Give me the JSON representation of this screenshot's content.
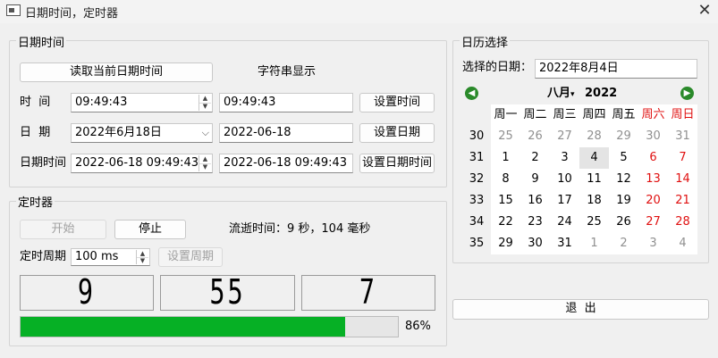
{
  "window": {
    "title": "日期时间，定时器",
    "close_glyph": "✕"
  },
  "datetime_group": {
    "title": "日期时间",
    "read_button": "读取当前日期时间",
    "string_display_label": "字符串显示",
    "time_label": "时  间",
    "time_value": "09:49:43",
    "time_string": "09:49:43",
    "set_time_button": "设置时间",
    "date_label": "日  期",
    "date_value": "2022年6月18日",
    "date_string": "2022-06-18",
    "set_date_button": "设置日期",
    "datetime_label": "日期时间",
    "datetime_value": "2022-06-18 09:49:43",
    "datetime_string": "2022-06-18 09:49:43",
    "set_datetime_button": "设置日期时间"
  },
  "timer_group": {
    "title": "定时器",
    "start_button": "开始",
    "stop_button": "停止",
    "elapsed_text": "流逝时间：9 秒，104 毫秒",
    "period_label": "定时周期",
    "period_value": "100 ms",
    "set_period_button": "设置周期",
    "lcd_hours": "9",
    "lcd_minutes": "55",
    "lcd_seconds": "7",
    "progress_percent": 86,
    "progress_text": "86%"
  },
  "calendar_group": {
    "title": "日历选择",
    "selected_label": "选择的日期：",
    "selected_value": "2022年8月4日",
    "month_label": "八月",
    "year_label": "2022",
    "weekdays": [
      "周一",
      "周二",
      "周三",
      "周四",
      "周五",
      "周六",
      "周日"
    ],
    "week_numbers": [
      "30",
      "31",
      "32",
      "33",
      "34",
      "35"
    ],
    "weeks": [
      [
        "25",
        "26",
        "27",
        "28",
        "29",
        "30",
        "31"
      ],
      [
        "1",
        "2",
        "3",
        "4",
        "5",
        "6",
        "7"
      ],
      [
        "8",
        "9",
        "10",
        "11",
        "12",
        "13",
        "14"
      ],
      [
        "15",
        "16",
        "17",
        "18",
        "19",
        "20",
        "21"
      ],
      [
        "22",
        "23",
        "24",
        "25",
        "26",
        "27",
        "28"
      ],
      [
        "29",
        "30",
        "31",
        "1",
        "2",
        "3",
        "4"
      ]
    ]
  },
  "exit_button": "退  出",
  "colors": {
    "progress": "#06b025",
    "weekend": "#e01010",
    "other_month": "#909090",
    "nav": "#2a8a2a"
  }
}
